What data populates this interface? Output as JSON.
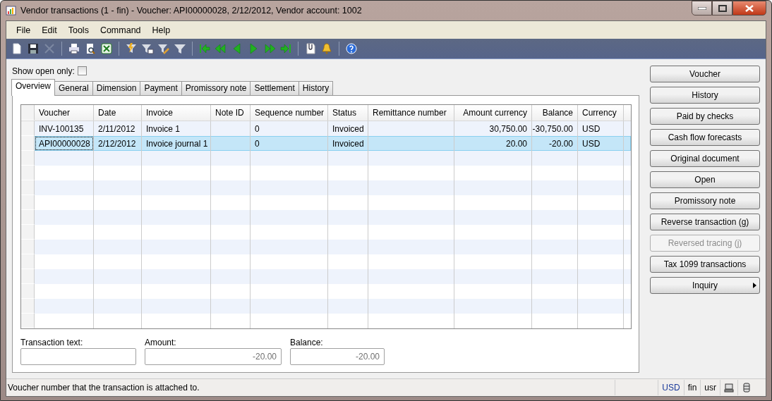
{
  "window": {
    "title": "Vendor transactions (1 - fin) - Voucher: API00000028, 2/12/2012, Vendor account: 1002"
  },
  "menu": [
    "File",
    "Edit",
    "Tools",
    "Command",
    "Help"
  ],
  "toolbar": [
    {
      "kind": "new",
      "disabled": false
    },
    {
      "kind": "save",
      "disabled": false
    },
    {
      "kind": "delete",
      "disabled": true
    },
    {
      "kind": "sep"
    },
    {
      "kind": "print",
      "disabled": false
    },
    {
      "kind": "preview",
      "disabled": false
    },
    {
      "kind": "excel",
      "disabled": false
    },
    {
      "kind": "sep"
    },
    {
      "kind": "filter-quick",
      "disabled": false
    },
    {
      "kind": "filter-grid",
      "disabled": false
    },
    {
      "kind": "filter-edit",
      "disabled": false
    },
    {
      "kind": "filter",
      "disabled": false
    },
    {
      "kind": "sep"
    },
    {
      "kind": "first",
      "disabled": false
    },
    {
      "kind": "prev-page",
      "disabled": false
    },
    {
      "kind": "prev",
      "disabled": false
    },
    {
      "kind": "next",
      "disabled": false
    },
    {
      "kind": "next-page",
      "disabled": false
    },
    {
      "kind": "last",
      "disabled": false
    },
    {
      "kind": "sep"
    },
    {
      "kind": "attach",
      "disabled": false
    },
    {
      "kind": "alert",
      "disabled": false
    },
    {
      "kind": "sep"
    },
    {
      "kind": "help",
      "disabled": false
    }
  ],
  "show_open_only": {
    "label": "Show open only:",
    "checked": false
  },
  "tabs": [
    {
      "label": "Overview",
      "selected": true
    },
    {
      "label": "General",
      "selected": false
    },
    {
      "label": "Dimension",
      "selected": false
    },
    {
      "label": "Payment",
      "selected": false
    },
    {
      "label": "Promissory note",
      "selected": false
    },
    {
      "label": "Settlement",
      "selected": false
    },
    {
      "label": "History",
      "selected": false
    }
  ],
  "table": {
    "columns": [
      {
        "label": "Voucher",
        "kind": "text"
      },
      {
        "label": "Date",
        "kind": "text"
      },
      {
        "label": "Invoice",
        "kind": "text"
      },
      {
        "label": "Note ID",
        "kind": "text"
      },
      {
        "label": "Sequence number",
        "kind": "text"
      },
      {
        "label": "Status",
        "kind": "text"
      },
      {
        "label": "Remittance number",
        "kind": "text"
      },
      {
        "label": "Amount currency",
        "kind": "amount"
      },
      {
        "label": "Balance",
        "kind": "amount"
      },
      {
        "label": "Currency",
        "kind": "text"
      }
    ],
    "rows": [
      {
        "selected": false,
        "cells": [
          "INV-100135",
          "2/11/2012",
          "Invoice 1",
          "",
          "0",
          "Invoiced",
          "",
          "30,750.00",
          "-30,750.00",
          "USD"
        ]
      },
      {
        "selected": true,
        "cells": [
          "API00000028",
          "2/12/2012",
          "Invoice journal 1",
          "",
          "0",
          "Invoiced",
          "",
          "20.00",
          "-20.00",
          "USD"
        ]
      }
    ]
  },
  "fields": [
    {
      "label": "Transaction text:"
    },
    {
      "label": "Amount:",
      "value": "-20.00"
    },
    {
      "label": "Balance:",
      "value": "-20.00"
    }
  ],
  "buttons": [
    {
      "label": "Voucher",
      "kind": "button",
      "disabled": false
    },
    {
      "label": "History",
      "kind": "button",
      "disabled": false
    },
    {
      "label": "Paid by checks",
      "kind": "button",
      "disabled": false
    },
    {
      "label": "Cash flow forecasts",
      "kind": "button",
      "disabled": false
    },
    {
      "label": "Original document",
      "kind": "button",
      "disabled": false
    },
    {
      "label": "Open",
      "kind": "button",
      "disabled": false
    },
    {
      "label": "Promissory note",
      "kind": "button",
      "disabled": false
    },
    {
      "label": "Reverse transaction (g)",
      "kind": "button",
      "disabled": false
    },
    {
      "label": "Reversed tracing (j)",
      "kind": "button",
      "disabled": true
    },
    {
      "label": "Tax 1099 transactions",
      "kind": "button",
      "disabled": false
    },
    {
      "label": "Inquiry",
      "kind": "menu",
      "disabled": false
    }
  ],
  "status_bar": {
    "message": "Voucher number that the transaction is attached to.",
    "currency": "USD",
    "company": "fin",
    "layer": "usr"
  }
}
